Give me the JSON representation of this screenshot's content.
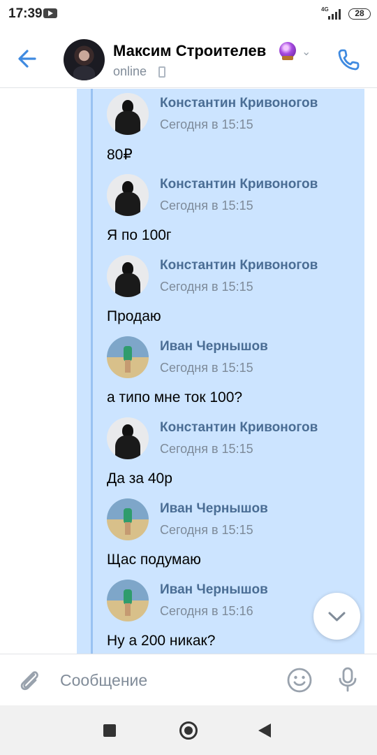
{
  "status_bar": {
    "time": "17:39",
    "network": "4G",
    "battery": "28"
  },
  "header": {
    "contact_name": "Максим Строителев",
    "status": "online",
    "accent_color": "#3f8ae0"
  },
  "forwarded_messages": [
    {
      "author": "Константин Кривоногов",
      "time": "Сегодня в 15:15",
      "text": "80₽",
      "avatar": "dark-silhouette"
    },
    {
      "author": "Константин Кривоногов",
      "time": "Сегодня в 15:15",
      "text": "Я по 100г",
      "avatar": "dark-silhouette"
    },
    {
      "author": "Константин Кривоногов",
      "time": "Сегодня в 15:15",
      "text": "Продаю",
      "avatar": "dark-silhouette"
    },
    {
      "author": "Иван Чернышов",
      "time": "Сегодня в 15:15",
      "text": "а типо мне ток 100?",
      "avatar": "beach-photo"
    },
    {
      "author": "Константин Кривоногов",
      "time": "Сегодня в 15:15",
      "text": "Да за 40р",
      "avatar": "dark-silhouette"
    },
    {
      "author": "Иван Чернышов",
      "time": "Сегодня в 15:15",
      "text": "Щас подумаю",
      "avatar": "beach-photo"
    },
    {
      "author": "Иван Чернышов",
      "time": "Сегодня в 15:16",
      "text": "Ну а 200 никак?",
      "avatar": "beach-photo"
    }
  ],
  "composer": {
    "placeholder": "Сообщение",
    "value": ""
  },
  "icons": {
    "back": "arrow-left-icon",
    "call": "phone-icon",
    "attach": "paperclip-icon",
    "emoji": "smile-icon",
    "mic": "microphone-icon",
    "scroll": "chevron-down-icon"
  }
}
